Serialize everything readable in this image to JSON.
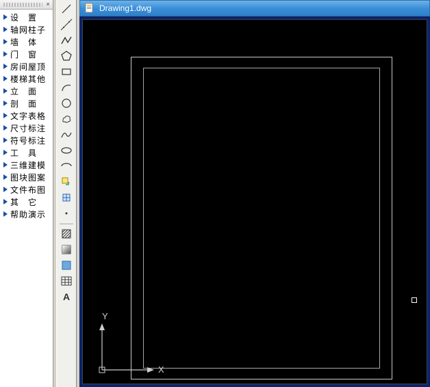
{
  "document": {
    "title": "Drawing1.dwg"
  },
  "sidebar": {
    "items": [
      {
        "label": "设　置"
      },
      {
        "label": "轴网柱子"
      },
      {
        "label": "墙　体"
      },
      {
        "label": "门　窗"
      },
      {
        "label": "房间屋顶"
      },
      {
        "label": "楼梯其他"
      },
      {
        "label": "立　面"
      },
      {
        "label": "剖　面"
      },
      {
        "label": "文字表格"
      },
      {
        "label": "尺寸标注"
      },
      {
        "label": "符号标注"
      },
      {
        "label": "工　具"
      },
      {
        "label": "三维建模"
      },
      {
        "label": "图块图案"
      },
      {
        "label": "文件布图"
      },
      {
        "label": "其　它"
      },
      {
        "label": "帮助演示"
      }
    ]
  },
  "tools": [
    {
      "name": "line-tool"
    },
    {
      "name": "construction-line-tool"
    },
    {
      "name": "polyline-tool"
    },
    {
      "name": "polygon-tool"
    },
    {
      "name": "rectangle-tool"
    },
    {
      "name": "arc-tool"
    },
    {
      "name": "circle-tool"
    },
    {
      "name": "revision-cloud-tool"
    },
    {
      "name": "spline-tool"
    },
    {
      "name": "ellipse-tool"
    },
    {
      "name": "ellipse-arc-tool"
    },
    {
      "name": "insert-block-tool"
    },
    {
      "name": "make-block-tool"
    },
    {
      "name": "point-tool"
    },
    {
      "name": "hatch-tool"
    },
    {
      "name": "gradient-tool"
    },
    {
      "name": "region-tool"
    },
    {
      "name": "table-tool"
    },
    {
      "name": "text-tool"
    }
  ],
  "ucs": {
    "y_label": "Y",
    "x_label": "X"
  }
}
